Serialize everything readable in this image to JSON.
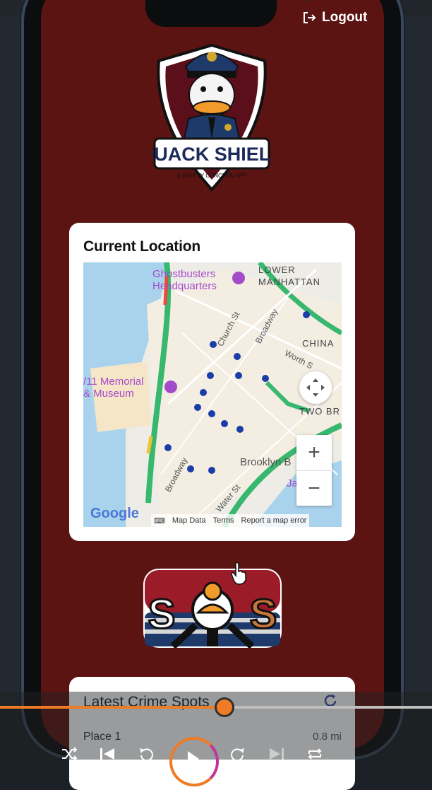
{
  "app": {
    "logout_label": "Logout",
    "logo_title": "QUACK SHIELD",
    "logo_subtitle": "& SAFETY CONCERN APP",
    "accent_color": "#5c1412"
  },
  "location_card": {
    "title": "Current Location",
    "map": {
      "labels": {
        "ghostbusters": "Ghostbusters\nHeadquarters",
        "lower_manhattan": "LOWER\nMANHATTAN",
        "chinatown": "CHINA",
        "memorial": "/11 Memorial\n& Museum",
        "two_bridges": "TWO BR",
        "brooklyn_bridge": "Brooklyn B",
        "ja": "Ja",
        "church_st": "Church St",
        "broadway_1": "Broadway",
        "worth_st": "Worth S",
        "broadway_2": "Broadway",
        "water_st": "Water St"
      },
      "google_logo": "Google",
      "attribution": {
        "map_data": "Map Data",
        "terms": "Terms",
        "report": "Report a map error"
      },
      "zoom_in": "+",
      "zoom_out": "−"
    }
  },
  "sos": {
    "label": "SOS"
  },
  "crime_card": {
    "title": "Latest Crime Spots",
    "items": [
      {
        "place": "Place 1",
        "distance": "0.8 mi"
      }
    ]
  },
  "player": {
    "progress": 0.52,
    "icons": [
      "shuffle-icon",
      "previous-icon",
      "rewind-icon",
      "play-icon",
      "forward-icon",
      "next-icon",
      "repeat-icon"
    ]
  }
}
